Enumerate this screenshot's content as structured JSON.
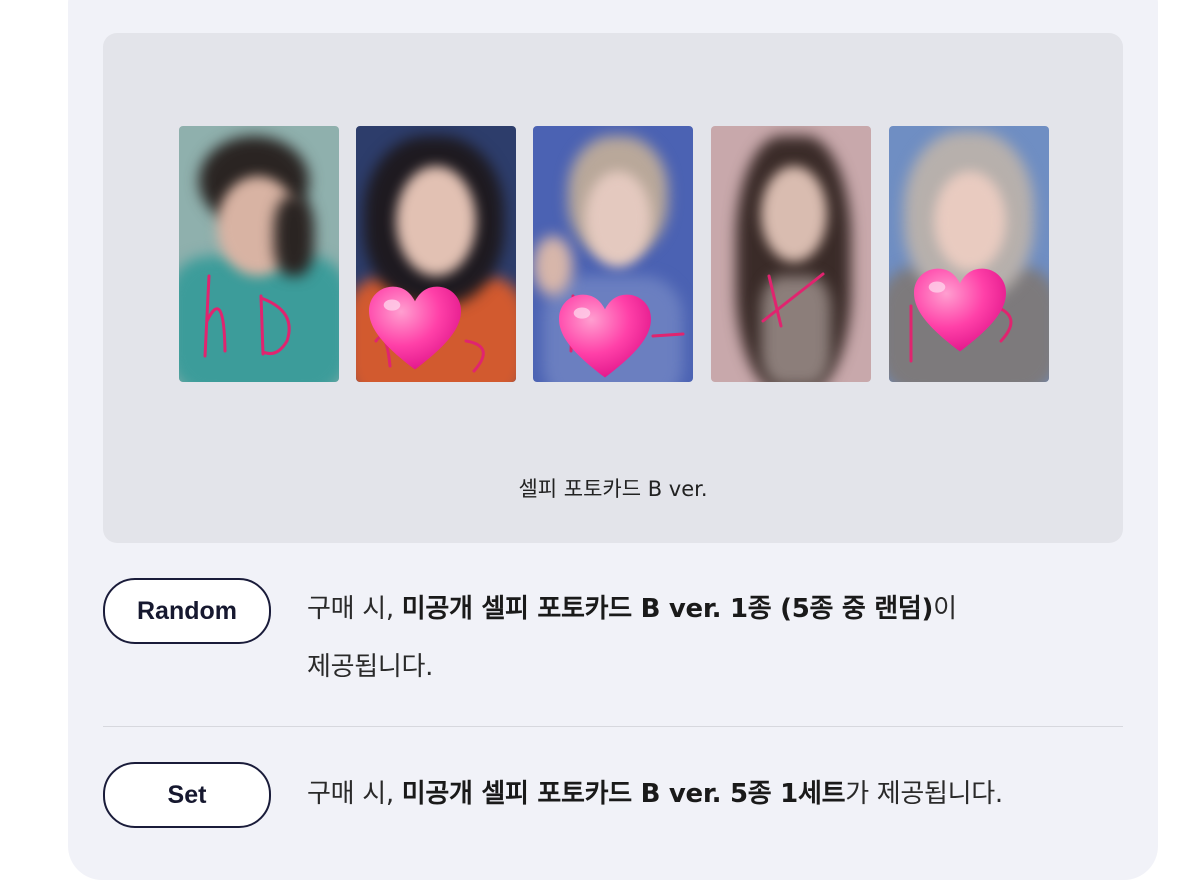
{
  "image_panel": {
    "caption": "셀피 포토카드 B ver.",
    "photocards": [
      {
        "name": "photocard-1",
        "bg": "#7fa9a8",
        "doodle": "hD",
        "heart": false
      },
      {
        "name": "photocard-2",
        "bg": "#2f3f6a",
        "doodle": "",
        "heart": true
      },
      {
        "name": "photocard-3",
        "bg": "#4a5fb0",
        "doodle": "",
        "heart": true
      },
      {
        "name": "photocard-4",
        "bg": "#c9a9ad",
        "doodle": "+",
        "heart": false
      },
      {
        "name": "photocard-5",
        "bg": "#6f8cc0",
        "doodle": "",
        "heart": true
      }
    ]
  },
  "options": [
    {
      "label": "Random",
      "text_pre": "구매 시, ",
      "text_bold": "미공개 셀피 포토카드 B ver. 1종 (5종 중 랜덤)",
      "text_post": "이",
      "text_line2": "제공됩니다."
    },
    {
      "label": "Set",
      "text_pre": "구매 시, ",
      "text_bold": "미공개 셀피 포토카드 B ver. 5종 1세트",
      "text_post": "가 제공됩니다."
    }
  ],
  "colors": {
    "card_bg": "#f1f2f8",
    "panel_bg": "#e3e4ea",
    "pill_border": "#1a1c3a",
    "heart": "#ff3fa4"
  }
}
